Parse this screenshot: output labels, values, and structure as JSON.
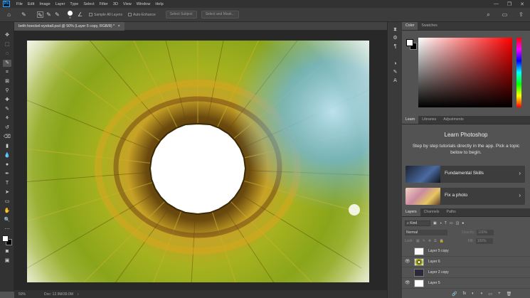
{
  "app": {
    "logo_text": "Ps"
  },
  "menu": [
    "File",
    "Edit",
    "Image",
    "Layer",
    "Type",
    "Select",
    "Filter",
    "3D",
    "View",
    "Window",
    "Help"
  ],
  "window_controls": [
    "—",
    "❐",
    "✕"
  ],
  "options_bar": {
    "brush_size": "5",
    "sample_all_layers": "Sample All Layers",
    "auto_enhance": "Auto-Enhance",
    "select_subject": "Select Subject",
    "select_and_mask": "Select and Mask..."
  },
  "document": {
    "tab_title": "beth-hoeckel-eyeball.psd @ 50% (Layer 5 copy, RGB/8) *",
    "tab_close": "×",
    "zoom": "50%",
    "doc_size": "Doc: 12.9M/39.0M"
  },
  "color_panel": {
    "tabs": [
      "Color",
      "Swatches"
    ]
  },
  "learn_panel": {
    "tabs": [
      "Learn",
      "Libraries",
      "Adjustments"
    ],
    "title": "Learn Photoshop",
    "description": "Step by step tutorials directly in the app. Pick a topic below to begin.",
    "cards": [
      {
        "label": "Fundamental Skills"
      },
      {
        "label": "Fix a photo"
      }
    ],
    "arrow": "›"
  },
  "layers_panel": {
    "tabs": [
      "Layers",
      "Channels",
      "Paths"
    ],
    "kind_label": "Kind",
    "blend_mode": "Normal",
    "opacity_label": "Opacity:",
    "opacity_value": "100%",
    "lock_label": "Lock:",
    "fill_label": "Fill:",
    "fill_value": "100%",
    "layers": [
      {
        "name": "Layer 5 copy",
        "visible": false
      },
      {
        "name": "Layer 6",
        "visible": true
      },
      {
        "name": "Layer 2 copy",
        "visible": false
      },
      {
        "name": "Layer 5",
        "visible": true
      }
    ],
    "bottom_icons": [
      "🔗",
      "fx",
      "◐",
      "◑",
      "▭",
      "+",
      "🗑"
    ]
  },
  "colors": {
    "menubar_bg": "#323232",
    "workspace_bg": "#535353",
    "iris_green": "#8aa51a",
    "iris_yellow": "#c9b52c",
    "highlight_blue": "#6fb7e3"
  }
}
